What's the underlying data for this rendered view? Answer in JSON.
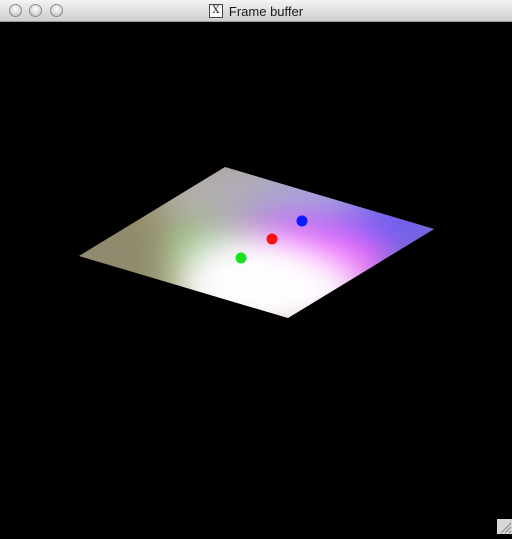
{
  "window": {
    "title": "Frame buffer",
    "title_icon": "x11-icon",
    "title_icon_glyph": "X"
  },
  "scene": {
    "background": "#000000",
    "plane_colors": [
      "#ffffff",
      "#ff66ff",
      "#6a5cff",
      "#9a8f6a"
    ],
    "lights": [
      {
        "name": "blue",
        "color": "#0a1cff"
      },
      {
        "name": "red",
        "color": "#ff1010"
      },
      {
        "name": "green",
        "color": "#1ae21a"
      }
    ]
  }
}
